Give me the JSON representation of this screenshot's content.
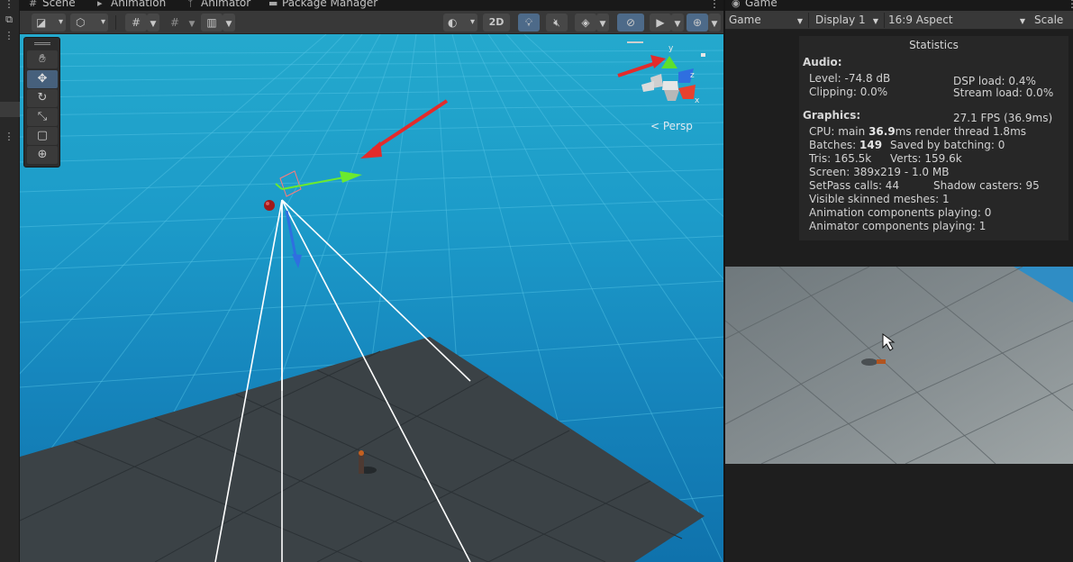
{
  "tabs": {
    "scene": "Scene",
    "animation": "Animation",
    "animator": "Animator",
    "package_manager": "Package Manager",
    "game": "Game"
  },
  "scene_toolbar": {
    "mode_2d": "2D"
  },
  "scene_view": {
    "projection_label": "< Persp",
    "axis_y": "y",
    "axis_z": "z",
    "axis_x": "x"
  },
  "game_toolbar": {
    "view_mode": "Game",
    "display": "Display 1",
    "aspect": "16:9 Aspect",
    "scale_label": "Scale"
  },
  "statistics": {
    "title": "Statistics",
    "audio_header": "Audio:",
    "level": "Level: -74.8 dB",
    "clipping": "Clipping: 0.0%",
    "dsp_load": "DSP load: 0.4%",
    "stream_load": "Stream load: 0.0%",
    "graphics_header": "Graphics:",
    "fps": "27.1 FPS (36.9ms)",
    "cpu_prefix": "CPU: main ",
    "cpu_main_value": "36.9",
    "cpu_suffix": "ms  render thread 1.8ms",
    "batches_prefix": "Batches: ",
    "batches_value": "149",
    "saved_by_batching": "Saved by batching: 0",
    "tris": "Tris: 165.5k",
    "verts": "Verts: 159.6k",
    "screen": "Screen: 389x219 - 1.0 MB",
    "setpass": "SetPass calls: 44",
    "shadow_casters": "Shadow casters: 95",
    "visible_skinned": "Visible skinned meshes: 1",
    "animation_components": "Animation components playing: 0",
    "animator_components": "Animator components playing: 1"
  },
  "colors": {
    "sky_top": "#24a9cd",
    "sky_bottom": "#0f72ac",
    "plane": "#3b4246",
    "annotation_arrow": "#e32b2b",
    "gizmo_x": "#e8412f",
    "gizmo_y": "#5ce02d",
    "gizmo_z": "#2f6fe0"
  }
}
